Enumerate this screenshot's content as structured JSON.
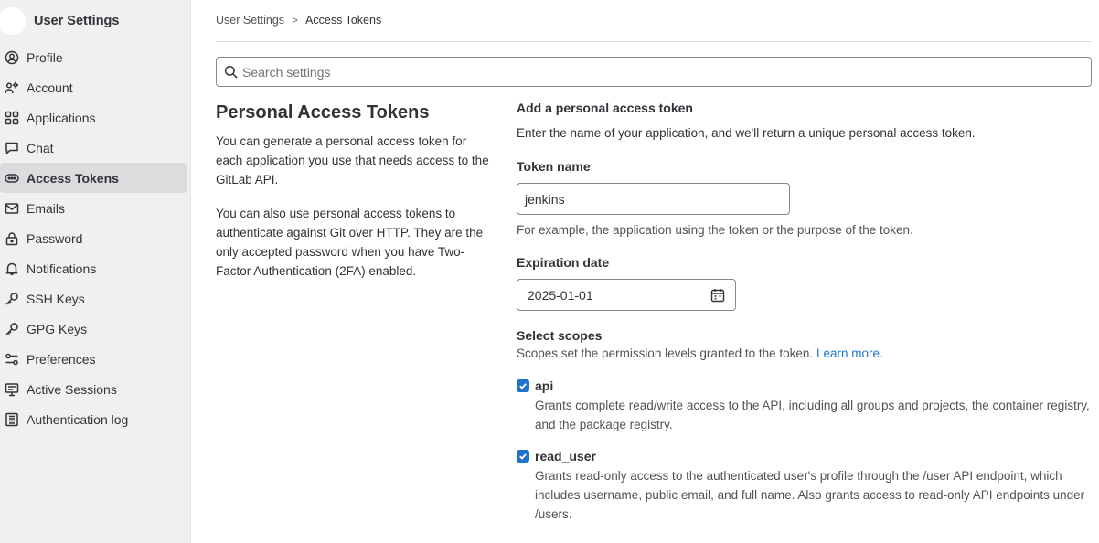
{
  "sidebar": {
    "title": "User Settings",
    "items": [
      {
        "label": "Profile",
        "icon": "profile-icon"
      },
      {
        "label": "Account",
        "icon": "account-icon"
      },
      {
        "label": "Applications",
        "icon": "applications-icon"
      },
      {
        "label": "Chat",
        "icon": "chat-icon"
      },
      {
        "label": "Access Tokens",
        "icon": "token-icon",
        "active": true
      },
      {
        "label": "Emails",
        "icon": "mail-icon"
      },
      {
        "label": "Password",
        "icon": "lock-icon"
      },
      {
        "label": "Notifications",
        "icon": "bell-icon"
      },
      {
        "label": "SSH Keys",
        "icon": "key-icon"
      },
      {
        "label": "GPG Keys",
        "icon": "key-icon"
      },
      {
        "label": "Preferences",
        "icon": "preferences-icon"
      },
      {
        "label": "Active Sessions",
        "icon": "monitor-icon"
      },
      {
        "label": "Authentication log",
        "icon": "log-icon"
      }
    ]
  },
  "breadcrumb": {
    "parent": "User Settings",
    "separator": ">",
    "current": "Access Tokens"
  },
  "search": {
    "placeholder": "Search settings"
  },
  "intro": {
    "title": "Personal Access Tokens",
    "paragraph1": "You can generate a personal access token for each application you use that needs access to the GitLab API.",
    "paragraph2": "You can also use personal access tokens to authenticate against Git over HTTP. They are the only accepted password when you have Two-Factor Authentication (2FA) enabled."
  },
  "form": {
    "title": "Add a personal access token",
    "description": "Enter the name of your application, and we'll return a unique personal access token.",
    "token_name_label": "Token name",
    "token_name_value": "jenkins",
    "token_name_help": "For example, the application using the token or the purpose of the token.",
    "expiration_label": "Expiration date",
    "expiration_value": "2025-01-01",
    "scopes_label": "Select scopes",
    "scopes_help": "Scopes set the permission levels granted to the token.",
    "learn_more": "Learn more.",
    "scopes": [
      {
        "name": "api",
        "checked": true,
        "description": "Grants complete read/write access to the API, including all groups and projects, the container registry, and the package registry."
      },
      {
        "name": "read_user",
        "checked": true,
        "description": "Grants read-only access to the authenticated user's profile through the /user API endpoint, which includes username, public email, and full name. Also grants access to read-only API endpoints under /users."
      }
    ]
  },
  "colors": {
    "link": "#1f75cb",
    "checkbox": "#1f75cb",
    "sidebar_bg": "#f0f0f0",
    "active_item_bg": "#dcdcde"
  }
}
